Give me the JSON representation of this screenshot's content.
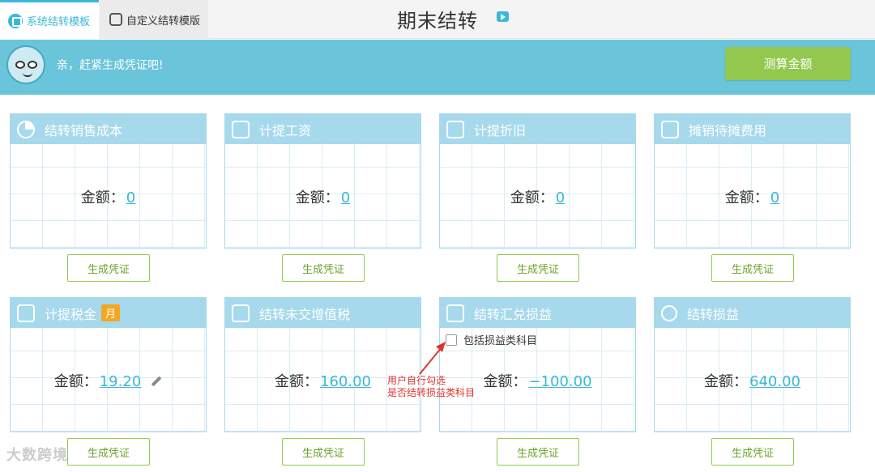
{
  "tabs": [
    {
      "label": "系统结转模板",
      "active": true
    },
    {
      "label": "自定义结转模版",
      "active": false
    }
  ],
  "title": "期末结转",
  "banner": {
    "message": "亲，赶紧生成凭证吧!",
    "calc_button": "测算金额"
  },
  "amount_label": "金额：",
  "cards": [
    {
      "title": "结转销售成本",
      "icon": "pie-chart-icon",
      "amount": "0",
      "button": "生成凭证"
    },
    {
      "title": "计提工资",
      "icon": "wallet-icon",
      "amount": "0",
      "button": "生成凭证"
    },
    {
      "title": "计提折旧",
      "icon": "documents-icon",
      "amount": "0",
      "button": "生成凭证"
    },
    {
      "title": "摊销待摊费用",
      "icon": "money-stack-icon",
      "amount": "0",
      "button": "生成凭证"
    },
    {
      "title": "计提税金",
      "icon": "tax-icon",
      "badge": "月",
      "amount": "19.20",
      "button": "生成凭证"
    },
    {
      "title": "结转未交增值税",
      "icon": "yen-icon",
      "amount": "160.00",
      "button": "生成凭证"
    },
    {
      "title": "结转汇兑损益",
      "icon": "clipboard-icon",
      "amount": "−100.00",
      "button": "生成凭证",
      "checkbox_label": "包括损益类科目"
    },
    {
      "title": "结转损益",
      "icon": "coins-icon",
      "amount": "640.00",
      "button": "生成凭证"
    }
  ],
  "annotation": {
    "line1": "用户自行勾选",
    "line2": "是否结转损益类科目"
  },
  "watermark": "大数跨境",
  "colors": {
    "accent": "#3ab8d8",
    "banner": "#6ac5db",
    "green": "#92c84e",
    "card_header": "#a6d9ec",
    "badge": "#f5a623",
    "annotation": "#e0342c"
  }
}
